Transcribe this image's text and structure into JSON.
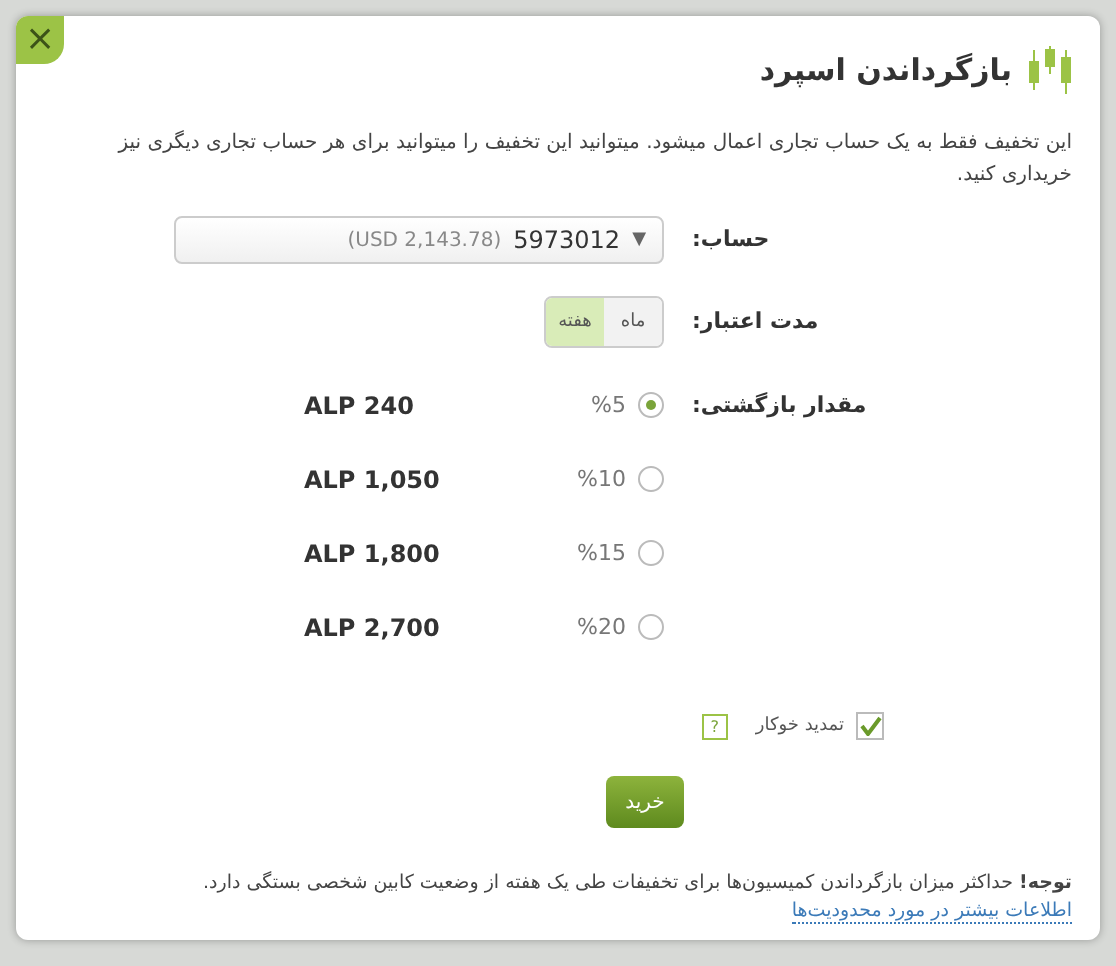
{
  "dialog": {
    "title": "بازگرداندن اسپرد",
    "close": "×"
  },
  "intro": "این تخفیف فقط به یک حساب تجاری اعمال میشود. میتوانید این تخفیف را میتوانید برای هر حساب تجاری دیگری نیز خریداری کنید.",
  "account": {
    "label": "حساب:",
    "number": "5973012",
    "balance": "(USD 2,143.78)",
    "caret": "▼"
  },
  "period": {
    "label": "مدت اعتبار:",
    "options": [
      {
        "label": "ماه",
        "selected": false
      },
      {
        "label": "هفته",
        "selected": true
      }
    ]
  },
  "refund": {
    "label": "مقدار بازگشتی:",
    "options": [
      {
        "percent": "%5",
        "amount": "ALP 240",
        "selected": true
      },
      {
        "percent": "%10",
        "amount": "ALP 1,050",
        "selected": false
      },
      {
        "percent": "%15",
        "amount": "ALP 1,800",
        "selected": false
      },
      {
        "percent": "%20",
        "amount": "ALP 2,700",
        "selected": false
      }
    ]
  },
  "auto_renew": {
    "label": "تمدید خوکار",
    "checked": true,
    "help": "?"
  },
  "buy_button": "خرید",
  "note": "**توجه!** حداکثر میزان بازگرداندن کمیسیون‌ها برای تخفیفات طی یک هفته از وضعیت کابین شخصی بستگی دارد.",
  "link": "اطلاعات بیشتر در مورد محدودیت‌ها"
}
